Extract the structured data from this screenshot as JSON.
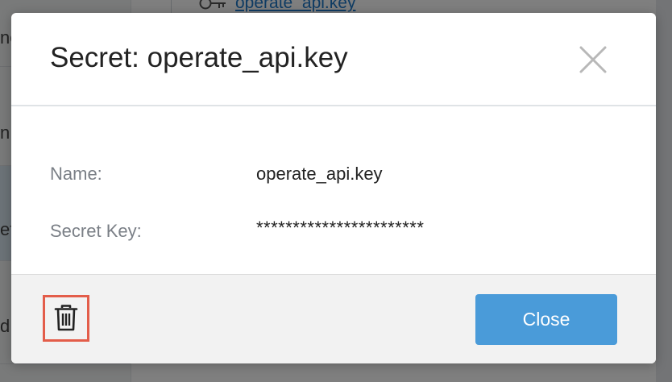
{
  "background": {
    "top_link": "operate_api.key",
    "left_fragments": [
      "ne",
      "n",
      "ef",
      "d"
    ]
  },
  "modal": {
    "title": "Secret: operate_api.key",
    "fields": [
      {
        "label": "Name:",
        "value": "operate_api.key"
      },
      {
        "label": "Secret Key:",
        "value": "***********************"
      }
    ],
    "close_label": "Close"
  },
  "icons": {
    "close": "close-x-icon",
    "delete": "trash-icon",
    "background_key": "key-icon"
  },
  "colors": {
    "primary_button": "#4a9bd9",
    "highlight_border": "#e35d4a",
    "link": "#1f78c8"
  }
}
